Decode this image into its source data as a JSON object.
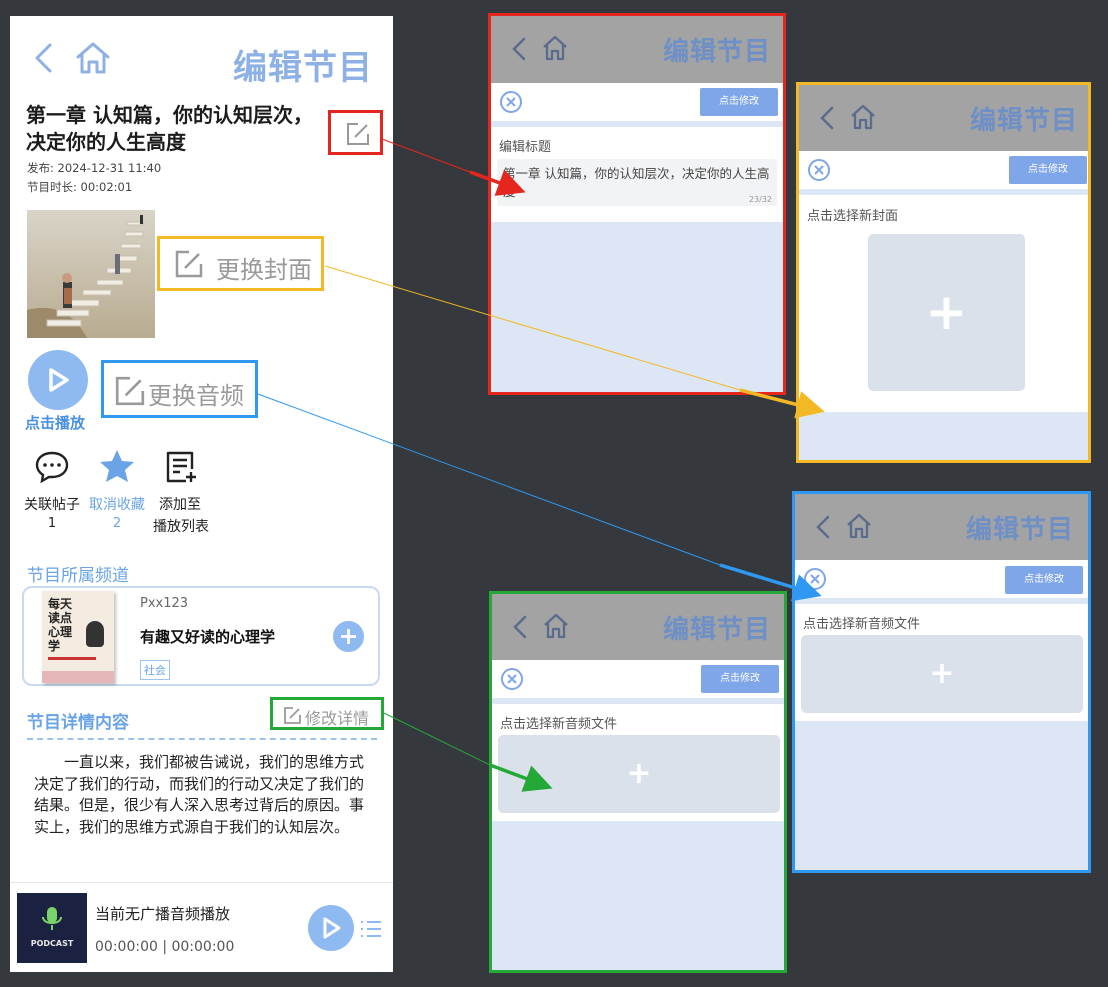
{
  "main": {
    "header_title": "编辑节目",
    "episode_title": "第一章 认知篇，你的认知层次，决定你的人生高度",
    "published": "发布: 2024-12-31 11:40",
    "duration": "节目时长: 00:02:01",
    "change_cover_label": "更换封面",
    "change_audio_label": "更换音频",
    "play_label": "点击播放",
    "actions": [
      {
        "label": "关联帖子",
        "count": "1"
      },
      {
        "label": "取消收藏",
        "count": "2"
      },
      {
        "label_line1": "添加至",
        "label_line2": "播放列表"
      }
    ],
    "channel_section_title": "节目所属频道",
    "channel": {
      "author": "Pxx123",
      "name": "有趣又好读的心理学",
      "tag": "社会",
      "book_title": "每天读点心理学"
    },
    "details_section_title": "节目详情内容",
    "edit_details_label": "修改详情",
    "description": "一直以来，我们都被告诫说，我们的思维方式决定了我们的行动，而我们的行动又决定了我们的结果。但是，很少有人深入思考过背后的原因。事实上，我们的思维方式源自于我们的认知层次。",
    "player": {
      "status": "当前无广播音频播放",
      "time": "00:00:00 | 00:00:00",
      "podcast_logo_text": "PODCAST"
    }
  },
  "screen_title": {
    "header_title": "编辑节目",
    "submit_label": "点击修改",
    "field_label": "编辑标题",
    "field_value": "第一章 认知篇，你的认知层次，决定你的人生高度",
    "counter": "23/32"
  },
  "screen_cover": {
    "header_title": "编辑节目",
    "submit_label": "点击修改",
    "field_label": "点击选择新封面",
    "plus": "+"
  },
  "screen_audio_blue": {
    "header_title": "编辑节目",
    "submit_label": "点击修改",
    "field_label": "点击选择新音频文件",
    "plus": "+"
  },
  "screen_audio_green": {
    "header_title": "编辑节目",
    "submit_label": "点击修改",
    "field_label": "点击选择新音频文件",
    "plus": "+"
  },
  "colors": {
    "red": "#e4261f",
    "yellow": "#f2b925",
    "blue": "#2f98f0",
    "green": "#24a838",
    "accent": "#8db1e4"
  }
}
